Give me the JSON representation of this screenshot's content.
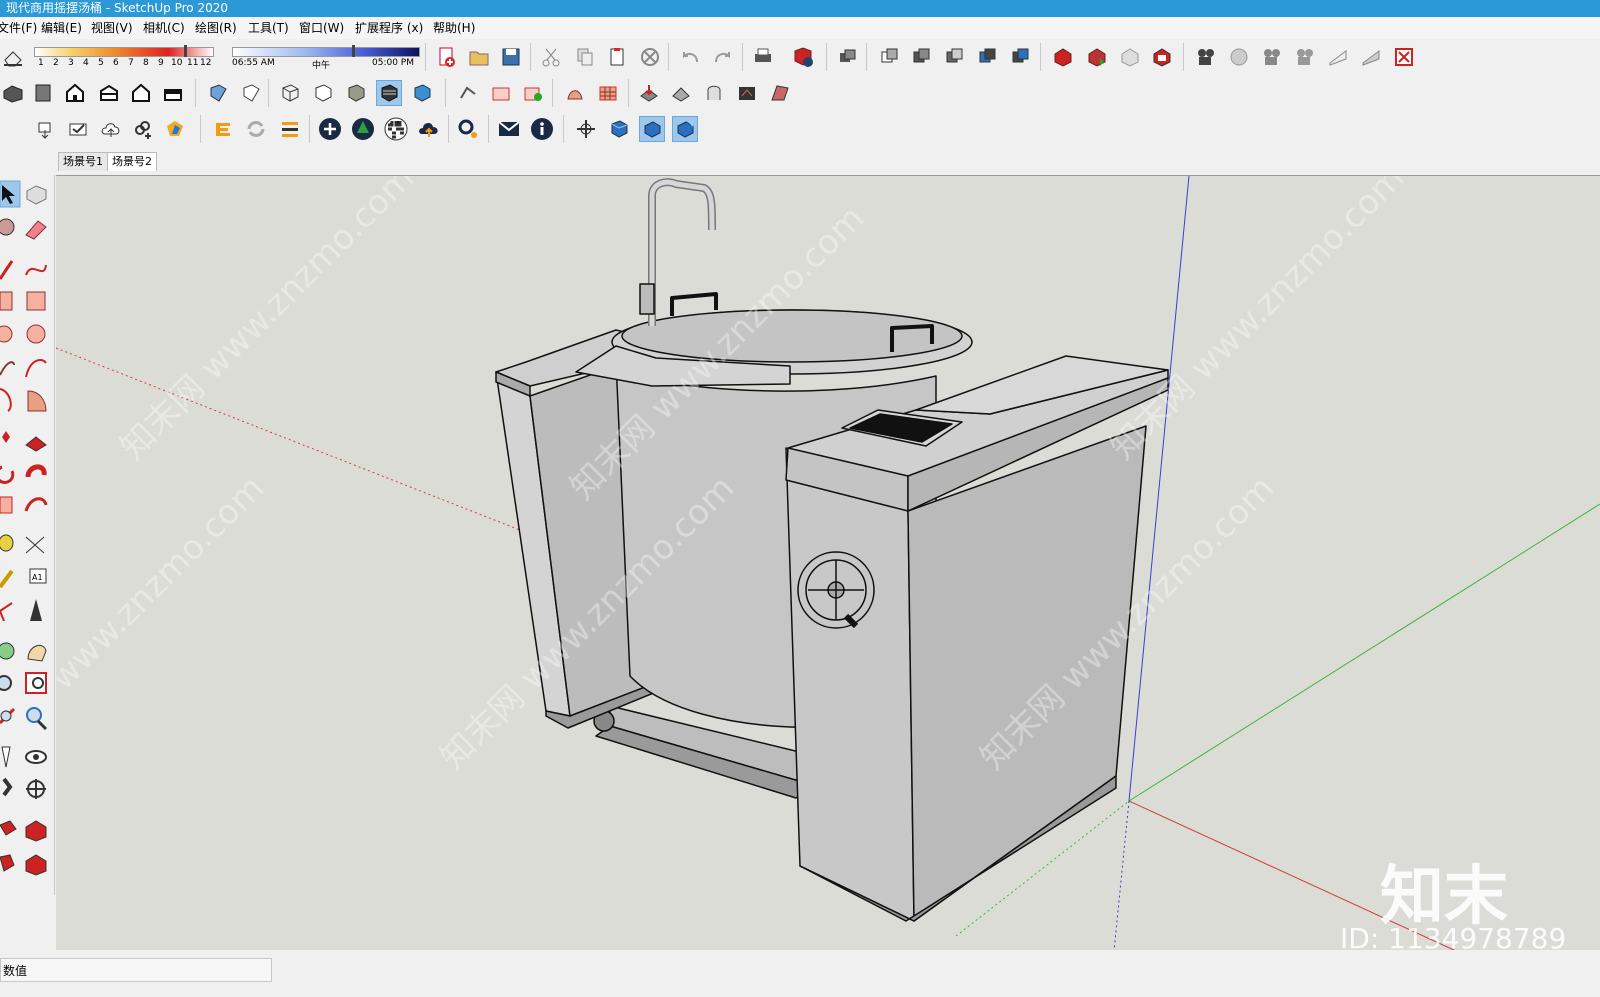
{
  "window": {
    "title": "现代商用摇摆汤桶 - SketchUp Pro 2020"
  },
  "menu": [
    {
      "id": "file",
      "label": "文件(F)"
    },
    {
      "id": "edit",
      "label": "编辑(E)"
    },
    {
      "id": "view",
      "label": "视图(V)"
    },
    {
      "id": "camera",
      "label": "相机(C)"
    },
    {
      "id": "draw",
      "label": "绘图(R)"
    },
    {
      "id": "tools",
      "label": "工具(T)"
    },
    {
      "id": "window",
      "label": "窗口(W)"
    },
    {
      "id": "extensions",
      "label": "扩展程序 (x)"
    },
    {
      "id": "help",
      "label": "帮助(H)"
    }
  ],
  "shadow": {
    "months": [
      "1",
      "2",
      "3",
      "4",
      "5",
      "6",
      "7",
      "8",
      "9",
      "10",
      "11",
      "12"
    ],
    "time_start": "06:55 AM",
    "time_mid": "中午",
    "time_end": "05:00 PM"
  },
  "scenes": [
    {
      "label": "场景号1",
      "selected": false
    },
    {
      "label": "场景号2",
      "selected": true
    }
  ],
  "statusbar": {
    "vcb_label": "数值"
  },
  "watermark": {
    "site": "知末网 www.znzmo.com",
    "logo": "知末",
    "id": "ID: 1134978789"
  },
  "colors": {
    "titlebar": "#2b99d6",
    "viewport_bg": "#dcdcd6",
    "axis_red": "#d23c3c",
    "axis_green": "#3cb43c",
    "axis_blue": "#3c3cd2"
  }
}
